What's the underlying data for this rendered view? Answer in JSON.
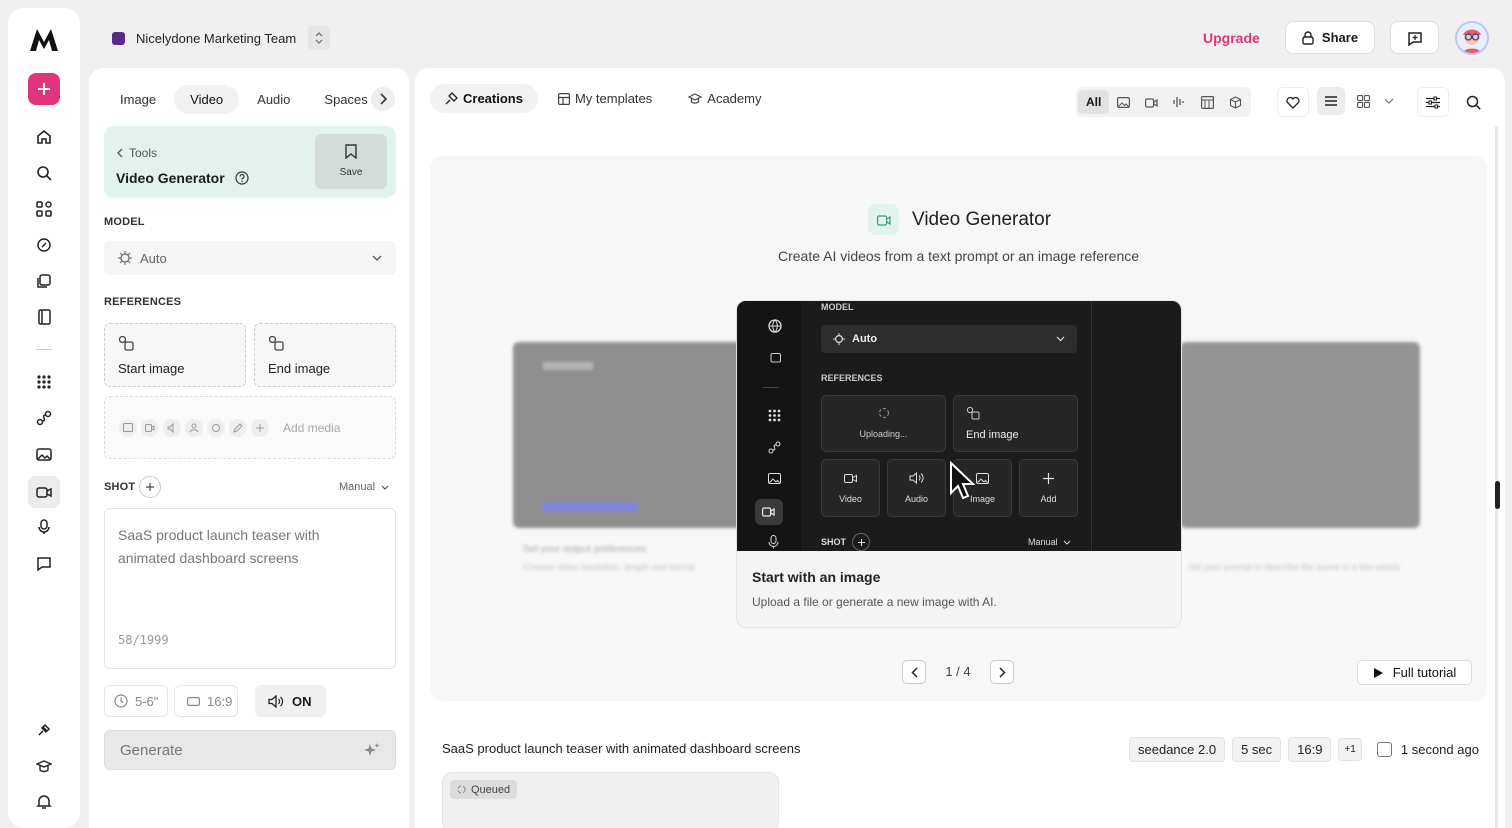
{
  "workspace": {
    "name": "Nicelydone Marketing Team",
    "color": "#5b2a86"
  },
  "header": {
    "upgrade": "Upgrade",
    "share": "Share"
  },
  "colors": {
    "accent": "#e0357c",
    "panel_green": "#e2f3ee"
  },
  "media_tabs": [
    "Image",
    "Video",
    "Audio",
    "Spaces"
  ],
  "tool": {
    "breadcrumb": "Tools",
    "title": "Video Generator",
    "save": "Save"
  },
  "model": {
    "label": "MODEL",
    "value": "Auto"
  },
  "references": {
    "label": "REFERENCES",
    "start": "Start image",
    "end": "End image",
    "add_media": "Add media"
  },
  "shot": {
    "label": "SHOT",
    "mode": "Manual",
    "prompt": "SaaS product launch teaser with animated dashboard screens",
    "count": "58/1999"
  },
  "settings": {
    "duration": "5-6\"",
    "ratio": "16:9",
    "audio": "ON"
  },
  "generate": "Generate",
  "main_tabs": [
    "Creations",
    "My templates",
    "Academy"
  ],
  "filter": {
    "all": "All"
  },
  "hero": {
    "title": "Video Generator",
    "subtitle": "Create AI videos from a text prompt or an image reference"
  },
  "card": {
    "title": "Start with an image",
    "desc": "Upload a file or generate a new image with AI.",
    "page": "1 / 4",
    "tutorial": "Full tutorial"
  },
  "preview": {
    "model_label": "MODEL",
    "model": "Auto",
    "refs_label": "REFERENCES",
    "uploading": "Uploading...",
    "end_image": "End image",
    "video": "Video",
    "audio": "Audio",
    "image": "Image",
    "add": "Add",
    "shot": "SHOT",
    "manual": "Manual"
  },
  "bg_cards": {
    "left_title": "Set your output preferences",
    "left_desc": "Choose video resolution, length and format",
    "right_desc": "Set your prompt to describe the scene in a few words"
  },
  "job": {
    "prompt": "SaaS product launch teaser with animated dashboard screens",
    "model": "seedance 2.0",
    "duration": "5 sec",
    "ratio": "16:9",
    "more": "+1",
    "time": "1 second ago",
    "status": "Queued"
  }
}
